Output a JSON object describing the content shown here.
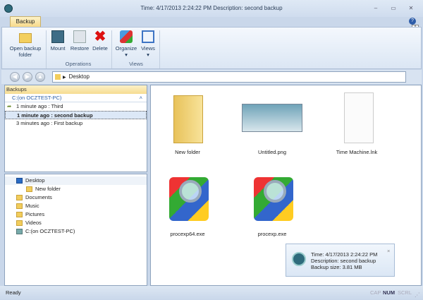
{
  "window": {
    "title": "Time: 4/17/2013 2:24:22 PM Description: second backup",
    "minimize": "–",
    "maximize": "▭",
    "close": "✕",
    "help": "?",
    "keytip": "A"
  },
  "ribbon": {
    "tab": "Backup",
    "buttons": {
      "open": "Open backup folder",
      "mount": "Mount",
      "restore": "Restore",
      "delete": "Delete",
      "organize": "Organize",
      "views": "Views"
    },
    "groups": {
      "operations": "Operations",
      "views": "Views"
    }
  },
  "address": {
    "path": "Desktop"
  },
  "backups": {
    "header": "Backups",
    "drive": "C:(on OCZTEST-PC)",
    "items": [
      "1 minute ago : Third",
      "1 minute ago : second backup",
      "3 minutes ago : First backup"
    ]
  },
  "tree": {
    "items": [
      "Desktop",
      "New folder",
      "Documents",
      "Music",
      "Pictures",
      "Videos",
      "C:(on OCZTEST-PC)"
    ]
  },
  "files": [
    "New folder",
    "Untitled.png",
    "Time Machine.lnk",
    "procexp64.exe",
    "procexp.exe"
  ],
  "toast": {
    "time": "Time: 4/17/2013 2:24:22 PM",
    "description": "Description: second backup",
    "size": "Backup size: 3.81 MB",
    "close": "×"
  },
  "status": {
    "text": "Ready",
    "cap": "CAP",
    "num": "NUM",
    "scrl": "SCRL"
  }
}
